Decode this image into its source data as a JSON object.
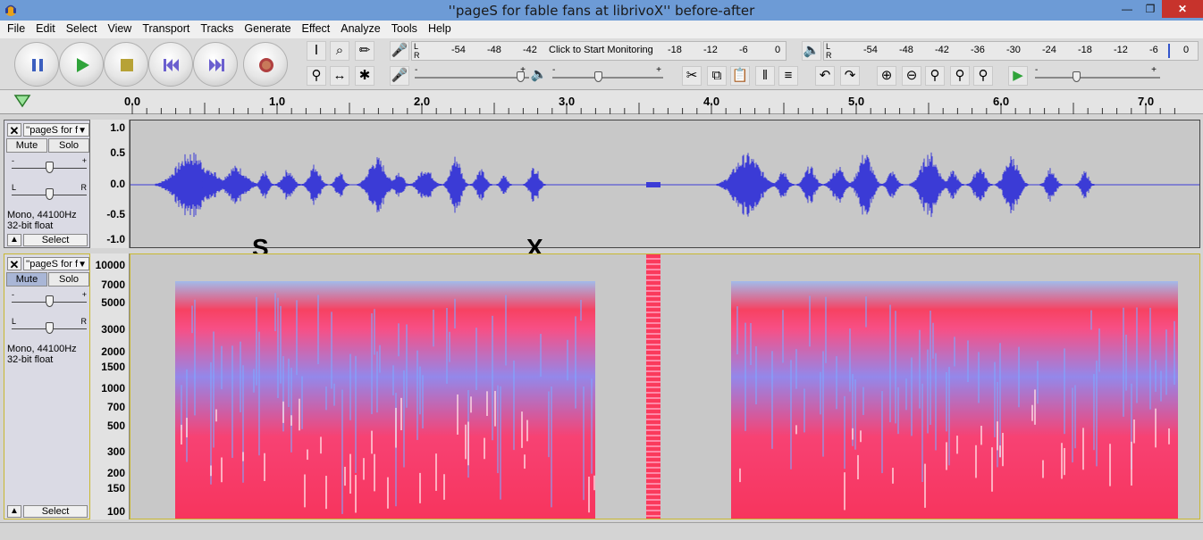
{
  "window": {
    "title": "''pageS for fable fans at librivoX'' before-after"
  },
  "menu": [
    "File",
    "Edit",
    "Select",
    "View",
    "Transport",
    "Tracks",
    "Generate",
    "Effect",
    "Analyze",
    "Tools",
    "Help"
  ],
  "record_meter": {
    "channels": "L\nR",
    "ticks": [
      "-54",
      "-48",
      "-42",
      "-18",
      "-12",
      "-6",
      "0"
    ],
    "monitor_label": "Click to Start Monitoring"
  },
  "play_meter": {
    "channels": "L\nR",
    "ticks": [
      "-54",
      "-48",
      "-42",
      "-36",
      "-30",
      "-24",
      "-18",
      "-12",
      "-6",
      "0"
    ]
  },
  "slider_pm": {
    "minus": "-",
    "plus": "+"
  },
  "timeline": {
    "labels": [
      "0.0",
      "1.0",
      "2.0",
      "3.0",
      "4.0",
      "5.0",
      "6.0",
      "7.0"
    ]
  },
  "track1": {
    "name": "''pageS for f",
    "mute": "Mute",
    "solo": "Solo",
    "gain_minus": "-",
    "gain_plus": "+",
    "pan_l": "L",
    "pan_r": "R",
    "info1": "Mono, 44100Hz",
    "info2": "32-bit float",
    "select": "Select",
    "scale": [
      "1.0",
      "0.5",
      "0.0",
      "-0.5",
      "-1.0"
    ]
  },
  "track2": {
    "name": "''pageS for f",
    "mute": "Mute",
    "solo": "Solo",
    "gain_minus": "-",
    "gain_plus": "+",
    "pan_l": "L",
    "pan_r": "R",
    "info1": "Mono, 44100Hz",
    "info2": "32-bit float",
    "select": "Select",
    "scale": [
      "10000",
      "7000",
      "5000",
      "3000",
      "2000",
      "1500",
      "1000",
      "700",
      "500",
      "300",
      "200",
      "150",
      "100"
    ]
  },
  "annotations": {
    "s": "S",
    "x": "X"
  },
  "colors": {
    "wave": "#3b3bd6",
    "spec_hot": "#ff2a50",
    "spec_cool": "#7fa8ff",
    "title_bar": "#6d9bd6"
  }
}
